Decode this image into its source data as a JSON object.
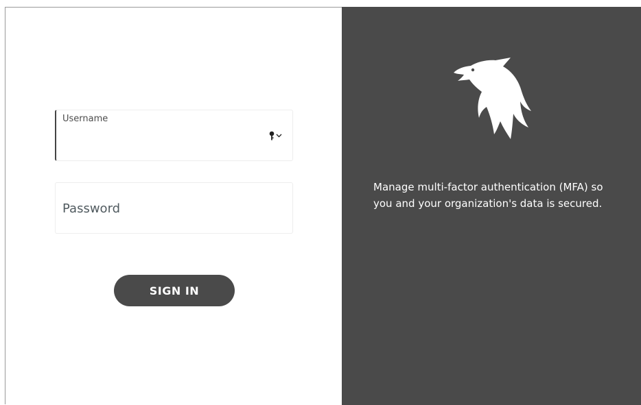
{
  "login": {
    "username_label": "Username",
    "username_value": "",
    "password_placeholder": "Password",
    "signin_label": "SIGN IN"
  },
  "icons": {
    "key": "key-icon",
    "dropdown": "chevron-down-icon",
    "logo": "eagle-logo"
  },
  "brand": {
    "panel_color": "#4a4a4a",
    "tagline_line1": "Manage multi-factor authentication (MFA) so",
    "tagline_line2": "you and your organization's data is secured."
  }
}
